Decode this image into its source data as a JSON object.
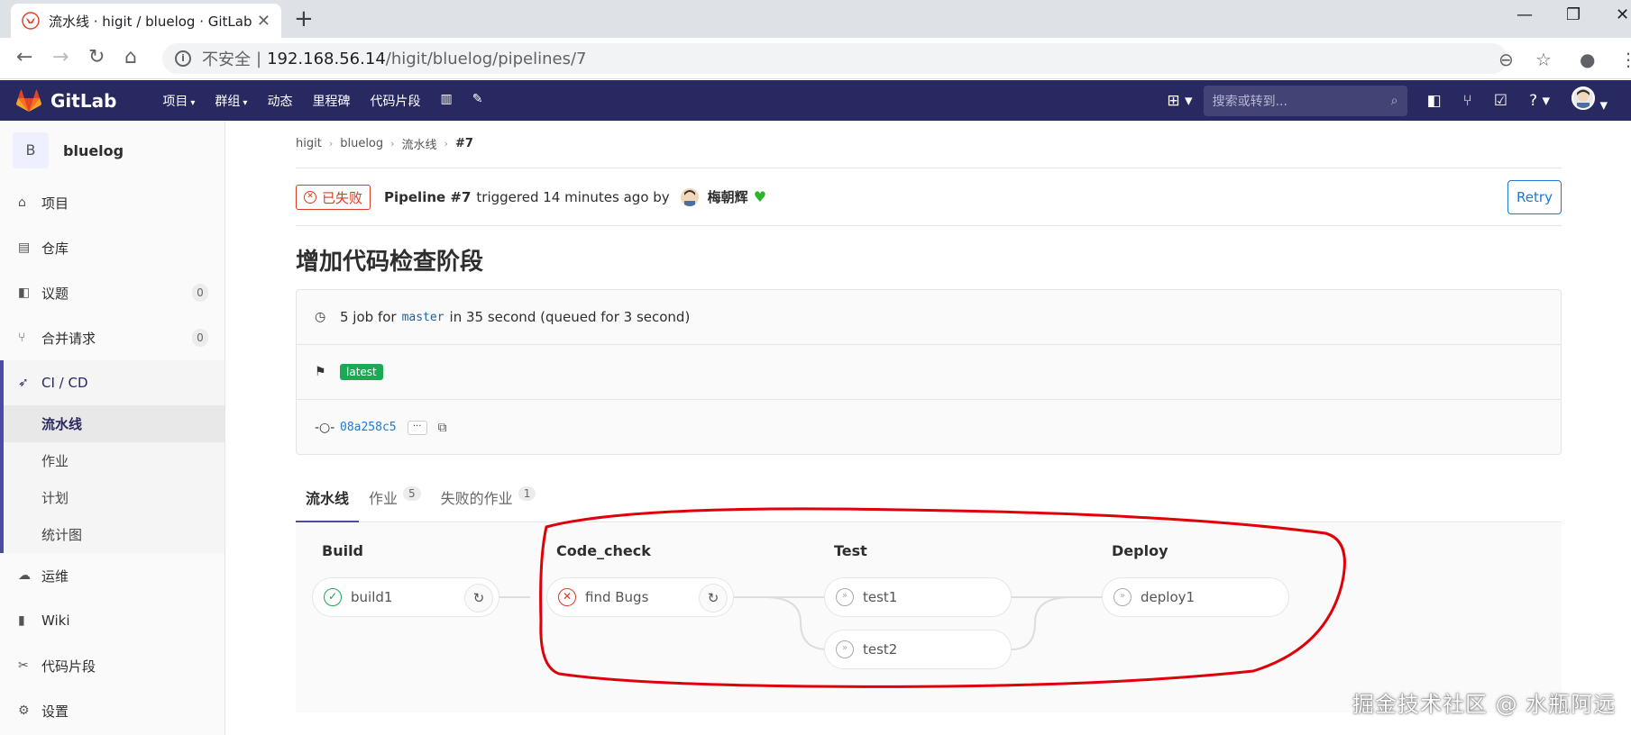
{
  "browser": {
    "tab_title": "流水线 · higit / bluelog · GitLab",
    "insecure_label": "不安全",
    "url_host": "192.168.56.14",
    "url_path": "/higit/bluelog/pipelines/7"
  },
  "header": {
    "brand": "GitLab",
    "nav": [
      {
        "label": "项目",
        "dropdown": true
      },
      {
        "label": "群组",
        "dropdown": true
      },
      {
        "label": "动态",
        "dropdown": false
      },
      {
        "label": "里程碑",
        "dropdown": false
      },
      {
        "label": "代码片段",
        "dropdown": false
      }
    ],
    "search_placeholder": "搜索或转到...",
    "colors": {
      "bg": "#292961",
      "accent": "#fc6d26"
    }
  },
  "sidebar": {
    "project_initial": "B",
    "project_name": "bluelog",
    "items": [
      {
        "label": "项目",
        "icon": "home-icon"
      },
      {
        "label": "仓库",
        "icon": "doc-icon"
      },
      {
        "label": "议题",
        "icon": "issues-icon",
        "count": "0"
      },
      {
        "label": "合并请求",
        "icon": "merge-icon",
        "count": "0"
      }
    ],
    "cicd": {
      "label": "CI / CD",
      "subitems": [
        "流水线",
        "作业",
        "计划",
        "统计图"
      ]
    },
    "bottom_items": [
      {
        "label": "运维",
        "icon": "cloud-icon"
      },
      {
        "label": "Wiki",
        "icon": "book-icon"
      },
      {
        "label": "代码片段",
        "icon": "scissors-icon"
      },
      {
        "label": "设置",
        "icon": "gear-icon"
      }
    ]
  },
  "breadcrumb": [
    "higit",
    "bluelog",
    "流水线",
    "#7"
  ],
  "pipeline": {
    "status": "已失败",
    "id_label": "Pipeline #7",
    "triggered": "triggered 14 minutes ago by",
    "author": "梅朝辉",
    "retry_label": "Retry",
    "commit_title": "增加代码检查阶段",
    "jobs_prefix": "5 job for",
    "branch": "master",
    "jobs_suffix": "in 35 second (queued for 3 second)",
    "tag": "latest",
    "sha": "08a258c5",
    "more": "···"
  },
  "tabs": [
    {
      "label": "流水线",
      "count": ""
    },
    {
      "label": "作业",
      "count": "5"
    },
    {
      "label": "失败的作业",
      "count": "1"
    }
  ],
  "stages": [
    {
      "name": "Build",
      "jobs": [
        {
          "name": "build1",
          "status": "success"
        }
      ]
    },
    {
      "name": "Code_check",
      "jobs": [
        {
          "name": "find Bugs",
          "status": "failed"
        }
      ]
    },
    {
      "name": "Test",
      "jobs": [
        {
          "name": "test1",
          "status": "skipped"
        },
        {
          "name": "test2",
          "status": "skipped"
        }
      ]
    },
    {
      "name": "Deploy",
      "jobs": [
        {
          "name": "deploy1",
          "status": "skipped"
        }
      ]
    }
  ],
  "watermark": "掘金技术社区 @ 水瓶阿远"
}
